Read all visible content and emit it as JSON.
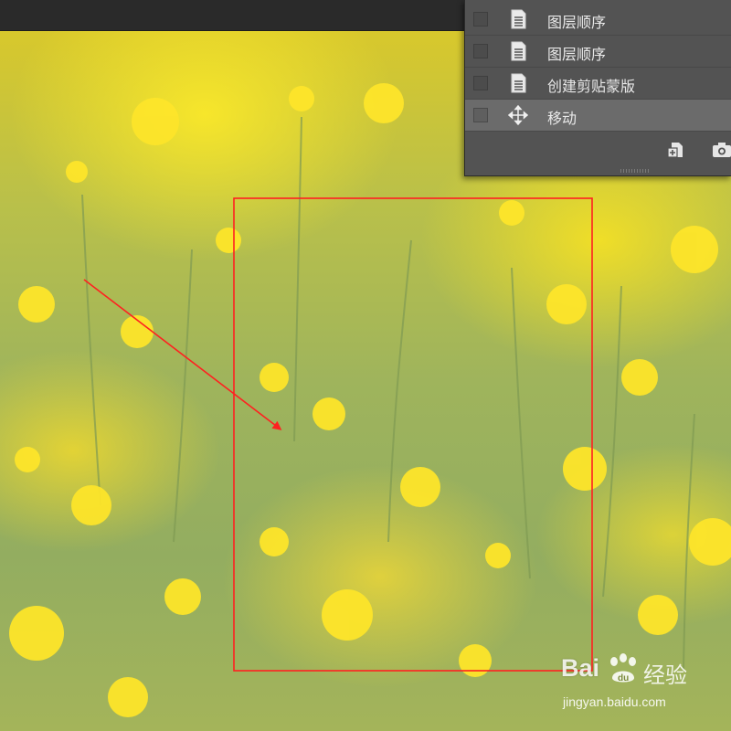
{
  "history_panel": {
    "items": [
      {
        "label": "图层顺序",
        "icon": "document-icon",
        "active": false
      },
      {
        "label": "图层顺序",
        "icon": "document-icon",
        "active": false
      },
      {
        "label": "创建剪贴蒙版",
        "icon": "document-icon",
        "active": false
      },
      {
        "label": "移动",
        "icon": "move-icon",
        "active": true
      }
    ],
    "footer_buttons": [
      {
        "icon": "new-document-from-state-icon"
      },
      {
        "icon": "camera-snapshot-icon"
      }
    ]
  },
  "annotation": {
    "color": "#ff2020"
  },
  "watermark": {
    "brand": "Bai",
    "brand_suffix": "经验",
    "url": "jingyan.baidu.com"
  }
}
